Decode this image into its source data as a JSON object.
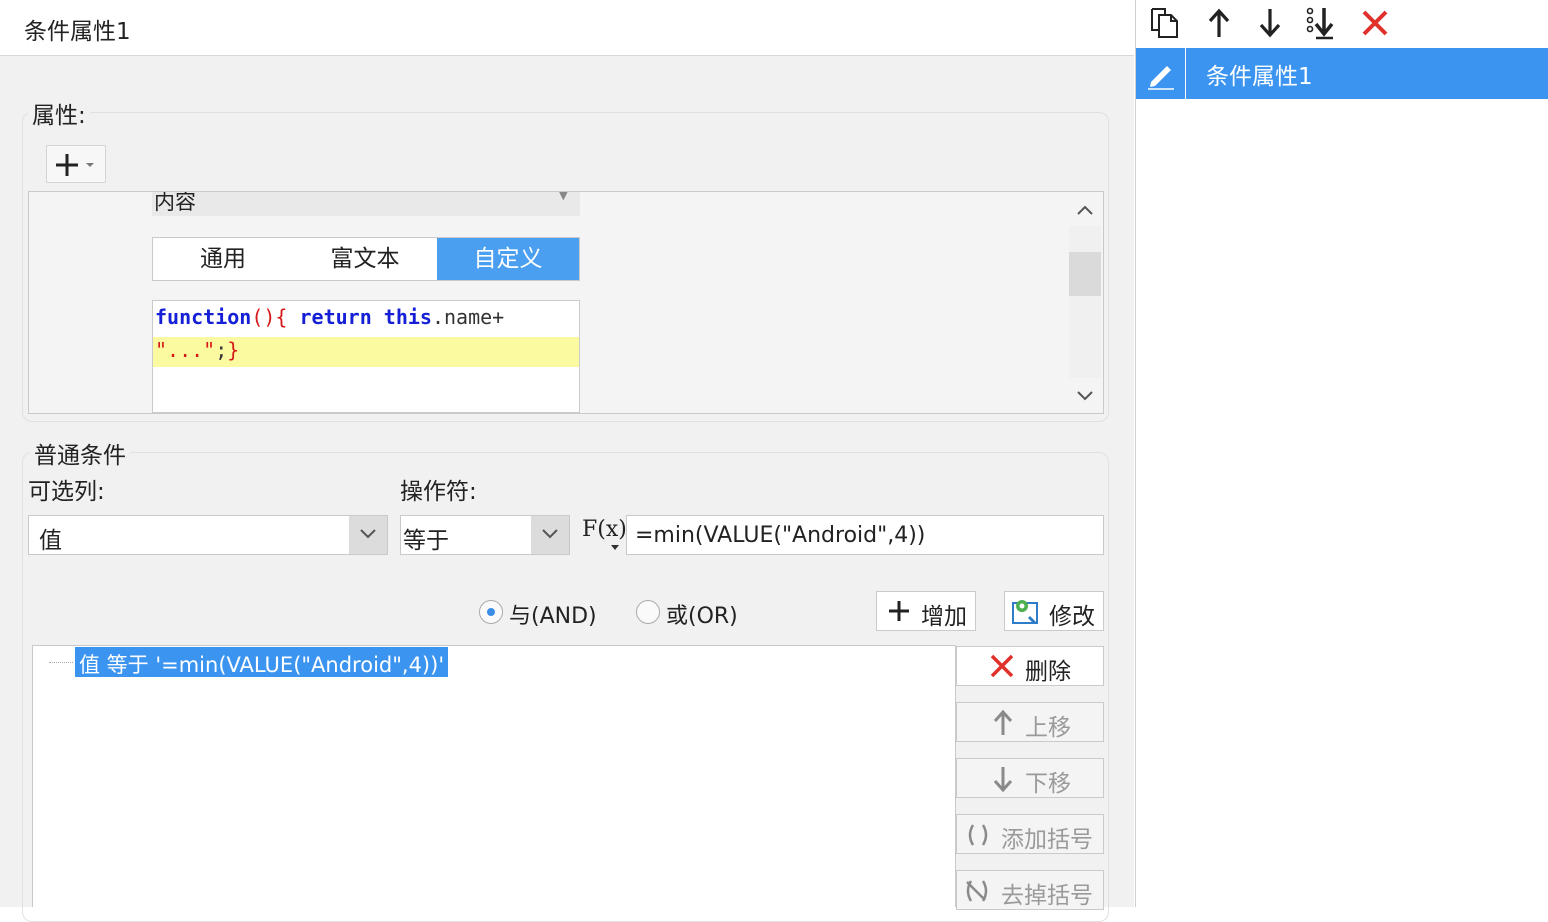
{
  "title": "条件属性1",
  "attributes": {
    "legend": "属性:",
    "content_label": "内容",
    "tabs": [
      {
        "label": "通用",
        "active": false
      },
      {
        "label": "富文本",
        "active": false
      },
      {
        "label": "自定义",
        "active": true
      }
    ],
    "code": {
      "kw_function": "function",
      "paren_open": "(){",
      "kw_return": "return",
      "kw_this": "this",
      "member": ".name+",
      "string": "\"...\"",
      "semi": ";",
      "brace_close": "}"
    }
  },
  "conditions": {
    "legend": "普通条件",
    "column_label": "可选列:",
    "operator_label": "操作符:",
    "column_value": "值",
    "operator_value": "等于",
    "fx_label": "F(x)",
    "formula_value": "=min(VALUE(\"Android\",4))",
    "and_label": "与(AND)",
    "or_label": "或(OR)",
    "logic_selected": "AND",
    "add_label": "增加",
    "modify_label": "修改",
    "delete_label": "删除",
    "move_up_label": "上移",
    "move_down_label": "下移",
    "add_bracket_label": "添加括号",
    "remove_bracket_label": "去掉括号",
    "tree_node": "值 等于 '=min(VALUE(\"Android\",4))'"
  },
  "right_panel": {
    "toolbar": [
      "copy-icon",
      "arrow-up-icon",
      "arrow-down-icon",
      "move-bottom-icon",
      "delete-icon"
    ],
    "items": [
      {
        "label": "条件属性1",
        "selected": true
      }
    ]
  },
  "colors": {
    "accent": "#3b94f0",
    "delete": "#e0312b",
    "code_highlight": "#fbfaa0"
  }
}
